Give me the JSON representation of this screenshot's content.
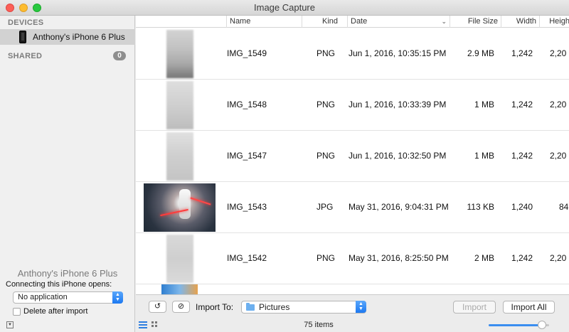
{
  "window": {
    "title": "Image Capture"
  },
  "sidebar": {
    "devices_header": "DEVICES",
    "device_name": "Anthony's iPhone 6 Plus",
    "shared_header": "SHARED",
    "shared_count": "0",
    "device_footer_name": "Anthony's iPhone 6 Plus",
    "connecting_label": "Connecting this iPhone opens:",
    "open_app_value": "No application",
    "delete_after_import_label": "Delete after import",
    "delete_after_import_checked": false
  },
  "table": {
    "columns": [
      "Name",
      "Kind",
      "Date",
      "File Size",
      "Width",
      "Height"
    ],
    "rows": [
      {
        "name": "IMG_1549",
        "kind": "PNG",
        "date": "Jun 1, 2016, 10:35:15 PM",
        "size": "2.9 MB",
        "width": "1,242",
        "height": "2,20"
      },
      {
        "name": "IMG_1548",
        "kind": "PNG",
        "date": "Jun 1, 2016, 10:33:39 PM",
        "size": "1 MB",
        "width": "1,242",
        "height": "2,20"
      },
      {
        "name": "IMG_1547",
        "kind": "PNG",
        "date": "Jun 1, 2016, 10:32:50 PM",
        "size": "1 MB",
        "width": "1,242",
        "height": "2,20"
      },
      {
        "name": "IMG_1543",
        "kind": "JPG",
        "date": "May 31, 2016, 9:04:31 PM",
        "size": "113 KB",
        "width": "1,240",
        "height": "84"
      },
      {
        "name": "IMG_1542",
        "kind": "PNG",
        "date": "May 31, 2016, 8:25:50 PM",
        "size": "2 MB",
        "width": "1,242",
        "height": "2,20"
      }
    ]
  },
  "toolbar": {
    "rotate_glyph": "↺",
    "delete_glyph": "⊘",
    "import_to_label": "Import To:",
    "destination": "Pictures",
    "import_label": "Import",
    "import_all_label": "Import All"
  },
  "status": {
    "item_count": "75 items",
    "thumbnail_size_fraction": 0.88
  },
  "colors": {
    "accent": "#2f7fe0"
  }
}
